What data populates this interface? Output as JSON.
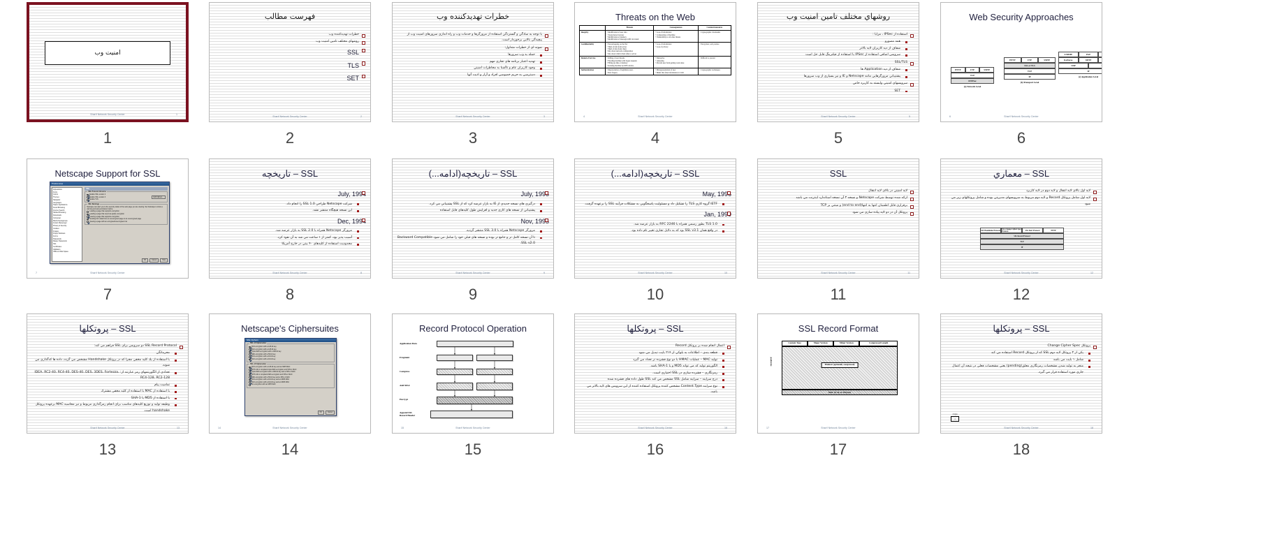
{
  "meta": {
    "footer": "Sharif Network Security Center",
    "app": "slide-sorter-thumbnail-grid",
    "accent_border": "#7b1220",
    "bullet_lvl1": "#8c1a1a",
    "bullet_lvl2": "#a01919"
  },
  "slides": [
    {
      "num": "6",
      "kind": "figure-en",
      "title": "Web Security Approaches",
      "figure": {
        "groups": [
          {
            "caption": "(a) Network Level",
            "rows": [
              [
                "HTTP",
                "FTP",
                "SMTP"
              ],
              [
                "TCP"
              ],
              [
                "IP/IPSec"
              ]
            ]
          },
          {
            "caption": "(b) Transport Level",
            "rows": [
              [
                "HTTP",
                "FTP",
                "SMTP"
              ],
              [
                "SSL or TLS"
              ],
              [
                "TCP"
              ],
              [
                "IP"
              ]
            ]
          },
          {
            "caption": "(c) Application Level",
            "rows": [
              [
                "S/MIME",
                "PGP",
                "SET"
              ],
              [
                "Kerberos",
                "SMTP",
                "HTTP"
              ],
              [
                "UDP",
                "TCP"
              ],
              [
                "IP"
              ]
            ]
          }
        ]
      },
      "pagenum": "6"
    },
    {
      "num": "5",
      "kind": "text-rtl",
      "title": "روشهاي مختلف تامين امنيت وب",
      "bullets": [
        {
          "level": 1,
          "text": "استفاده از IPSec ، مزايا :"
        },
        {
          "level": 2,
          "text": "همه مصورو"
        },
        {
          "level": 2,
          "text": "شفاف از ديد كاربران لايه بالاتر"
        },
        {
          "level": 2,
          "text": "سرويس اضافي استفاده از IPSec با استفاده از فيلترينگ قابل حل است"
        },
        {
          "level": 1,
          "text": "SSL/TLS"
        },
        {
          "level": 2,
          "text": "شفاف از ديد Application ها"
        },
        {
          "level": 2,
          "text": "پشتيباني مرورگرهايي مانند Netscape و IE و نيز بسياري از وب سرورها"
        },
        {
          "level": 1,
          "text": "سرويسهاي امنيتي وابسته به كاربرد خاص"
        },
        {
          "level": 2,
          "text": "SET"
        }
      ],
      "pagenum": "5"
    },
    {
      "num": "4",
      "kind": "table-en",
      "title": "Threats on the Web",
      "table": {
        "headers": [
          "",
          "Threats",
          "Consequences",
          "Countermeasures"
        ],
        "rows": [
          {
            "head": "Integrity",
            "threats": [
              "Modification of user data",
              "Trojan horse browser",
              "Modification of memory",
              "Modification of message traffic in transit"
            ],
            "consequences": [
              "Loss of information",
              "Compromise of machine",
              "Vulnerability to all other threats"
            ],
            "counter": [
              "Cryptographic checksums"
            ]
          },
          {
            "head": "Confidentiality",
            "threats": [
              "Eavesdropping on the Net",
              "Theft of info from server",
              "Theft of data from client",
              "Info about network configuration",
              "Info about which client talks to server"
            ],
            "consequences": [
              "Loss of information",
              "Loss of privacy"
            ],
            "counter": [
              "Encryption, web proxies"
            ]
          },
          {
            "head": "Denial of Service",
            "threats": [
              "Killing of user threads",
              "Flooding machine with bogus requests",
              "Filling up disk or memory",
              "Isolating machine by DNS attacks"
            ],
            "consequences": [
              "Disruptive",
              "Annoying",
              "Prevent user from getting work done"
            ],
            "counter": [
              "Difficult to prevent"
            ]
          },
          {
            "head": "Authentication",
            "threats": [
              "Impersonation of legitimate users",
              "Data forgery"
            ],
            "consequences": [
              "Misrepresentation of user",
              "Belief that false information is valid"
            ],
            "counter": [
              "Cryptographic techniques"
            ]
          }
        ]
      },
      "pagenum": "4"
    },
    {
      "num": "3",
      "kind": "text-rtl",
      "title": "خطرات تهديدكننده وب",
      "bullets": [
        {
          "level": 1,
          "text": "با توجه به سادگي و گستردگي استفاده از مرورگرها و خدمات وب و راه اندازي سرورهاي امنيت وب از پيچيدگي بالايي برخوردار است."
        },
        {
          "level": 1,
          "text": "نمونه اي از خطرات متداول:"
        },
        {
          "level": 2,
          "text": "حمله به وب سرورها"
        },
        {
          "level": 2,
          "text": "تهديد اعتبار برنامه هاي تجاري مهم"
        },
        {
          "level": 2,
          "text": "وجود كاربران عام و ناآشنا به مخاطرات امنيتي"
        },
        {
          "level": 2,
          "text": "دسترسي به حريم خصوصي افراد و آزار و اذيت آنها"
        }
      ],
      "pagenum": "3"
    },
    {
      "num": "2",
      "kind": "text-rtl",
      "title": "فهرست مطالب",
      "bullets": [
        {
          "level": 1,
          "text": "خطرات تهديدكننده وب"
        },
        {
          "level": 1,
          "text": "روشهاي مختلف تامين امنيت وب"
        },
        {
          "level": 1,
          "text": "SSL",
          "big": true
        },
        {
          "level": 1,
          "text": "TLS",
          "big": true
        },
        {
          "level": 1,
          "text": "SET",
          "big": true
        }
      ],
      "pagenum": "2"
    },
    {
      "num": "1",
      "kind": "title-slide",
      "title": "امنيت وب",
      "pagenum": "1"
    },
    {
      "num": "12",
      "kind": "text-rtl-figure",
      "title": "SSL – معماري",
      "bullets": [
        {
          "level": 1,
          "text": "لايه اول بالاي لايه انتقال و لايه دوم در لايه كاربرد"
        },
        {
          "level": 1,
          "text": "لايه اول شامل پروتكل Record و لايه دوم مربوط به سرويسهاي مديريتي بوده و شامل پروتكلهاي زير مي شود"
        }
      ],
      "figure": {
        "rows": [
          [
            "SSL Handshake Protocol",
            "SSL Change Cipher Spec Protocol",
            "SSL Alert Protocol",
            "HTTP"
          ],
          [
            "SSL Record Protocol"
          ],
          [
            "TCP"
          ],
          [
            "IP"
          ]
        ]
      },
      "pagenum": "12"
    },
    {
      "num": "11",
      "kind": "text-rtl",
      "title": "SSL",
      "bullets": [
        {
          "level": 1,
          "text": "لايه امنيتي در بالاي لايه انتقال"
        },
        {
          "level": 1,
          "text": "ارائه شده توسط شركت Netscape و نسخه ۳ آن نسخه استاندارد اينترنت مي باشد"
        },
        {
          "level": 1,
          "text": "برقراري قابل اطمينان انتها به انتها(end to end) و مبتني بر TCP"
        },
        {
          "level": 1,
          "text": "پروتكل آن در دو لايه پياده سازي مي شود"
        }
      ],
      "pagenum": "11"
    },
    {
      "num": "10",
      "kind": "text-rtl",
      "title": "SSL – تاريخچه(ادامه...)",
      "bullets": [
        {
          "level": 1,
          "text": "May, 1996",
          "date": true
        },
        {
          "level": 2,
          "text": "IETF گروه كاري TLS را تشكيل داد و مسئوليت پاسخگويي به مشكلات فرآيند SSL را برعهده گرفت."
        },
        {
          "level": 1,
          "text": "Jan, 1999",
          "date": true
        },
        {
          "level": 2,
          "text": "TLS 1.0 بطور رسمي همراه با RFC 2246 به بازار عرضه شد."
        },
        {
          "level": 2,
          "text": "در واقع همان SSL v3.1 بود كه به دلايل تجاري تغيير نام داده بود."
        }
      ],
      "pagenum": "10"
    },
    {
      "num": "9",
      "kind": "text-rtl",
      "title": "SSL – تاريخچه(ادامه...)",
      "bullets": [
        {
          "level": 1,
          "text": "July, 1995",
          "date": true
        },
        {
          "level": 2,
          "text": "درگيري هاي نسخه جديدي از IE به بازار عرضه كرد كه از SSL پشتيباني مي كرد."
        },
        {
          "level": 2,
          "text": "پشتيباني از نسخه هاي كاري جديد و افزايش طول كليدهاي قابل استفاده"
        },
        {
          "level": 1,
          "text": "Nov, 1995",
          "date": true
        },
        {
          "level": 2,
          "text": "مرورگر Netscape همراه با SSL 3.0 منتشر گرديد."
        },
        {
          "level": 2,
          "text": "تا آن نسخه كامل تر و جامع تر بوده و نسخه هاي قبلي خود را شامل مي شود Backward Compatible .SSL v2.0"
        }
      ],
      "pagenum": "9"
    },
    {
      "num": "8",
      "kind": "text-rtl",
      "title": "SSL – تاريخچه",
      "bullets": [
        {
          "level": 1,
          "text": "July, 1994",
          "date": true
        },
        {
          "level": 2,
          "text": "شركت Netscape طراحي SSL 1.0 را انجام داد."
        },
        {
          "level": 2,
          "text": "اين نسخه هيچگاه منتشر نشد."
        },
        {
          "level": 1,
          "text": "Dec, 1994",
          "date": true
        },
        {
          "level": 2,
          "text": "مرورگر Netscape همراه با SSL 2.0 به بازار عرضه شد."
        },
        {
          "level": 2,
          "text": "آسيب پذير بود، كمتر از ۱ ساعت مي شد به آن نفوذ كرد."
        },
        {
          "level": 2,
          "text": "محدوديت استفاده از كليدهاي ۴۰ بيتي در خارج آمريكا"
        }
      ],
      "pagenum": "8"
    },
    {
      "num": "7",
      "kind": "dialog-en",
      "title": "Netscape Support for SSL",
      "dialog": {
        "titlebar": "Preferences",
        "header": "SSL",
        "tree": [
          "Appearance",
          "Fonts",
          "Colors",
          "Themes",
          "Navigator",
          "Languages",
          "Helper Applications",
          "Smart Browsing",
          "Internet Search",
          "Tabbed Browsing",
          "Downloads",
          "Composer",
          "Mail & Newsgroups",
          "Instant Messenger",
          "Privacy & Security",
          "Cookies",
          "Images",
          "Popup Windows",
          "Forms",
          "Passwords",
          "Master Passwords",
          "SSL",
          "Certificates",
          "Validation",
          "Offline & Disk Space"
        ],
        "groups": [
          {
            "title": "SSL Protocol Versions",
            "items": [
              {
                "label": "Enable SSL version 2",
                "checked": true
              },
              {
                "label": "Enable SSL version 3",
                "checked": true
              },
              {
                "label": "Enable TLS",
                "checked": true
              }
            ],
            "button": "Edit Ciphers..."
          },
          {
            "title": "SSL Warnings",
            "note": "Netscape can alert you to the security status of the web page you are viewing. Set Netscape to show a warning and ask permission before:",
            "items": [
              {
                "label": "Loading a page that supports encryption",
                "checked": false
              },
              {
                "label": "Loading a page that uses low-grade encryption",
                "checked": true
              },
              {
                "label": "Leaving a page that supports encryption",
                "checked": true
              },
              {
                "label": "Sending form data from an unencrypted page to an unencrypted page",
                "checked": false
              },
              {
                "label": "Viewing a page with an encrypted/unencrypted mix",
                "checked": true
              }
            ]
          }
        ],
        "buttons": [
          "OK",
          "Cancel",
          "Help"
        ]
      },
      "pagenum": "7"
    },
    {
      "num": "18",
      "kind": "text-rtl-figure2",
      "title": "SSL – پروتكلها",
      "bullets": [
        {
          "level": 1,
          "text": "پروتكل Change Cipher Spec"
        },
        {
          "level": 2,
          "text": "يكي از ۳ پروتكل لايه دوم SSL كه از پروتكل Record استفاده مي كند"
        },
        {
          "level": 2,
          "text": "شامل ۱ بايت مي باشد"
        },
        {
          "level": 2,
          "text": "منجر به توليد شدن مشخصات رمزنگاري معلق(pending) بعني مشخصات فعلي در نتيجه آن اعمال جاري مورد استفاده قرار مي گيرد."
        }
      ],
      "figure": {
        "label": "1 byte",
        "cell": "1"
      },
      "pagenum": "18"
    },
    {
      "num": "17",
      "kind": "recordformat",
      "title": "SSL Record Format",
      "figure": {
        "header": [
          "Content Type",
          "Major Version",
          "Minor Version",
          "Compressed Length"
        ],
        "plaintext": "Plaintext (optionally compressed)",
        "mac": "MAC (0, 16, or 20 bytes)",
        "side": "encrypted"
      },
      "pagenum": "17"
    },
    {
      "num": "16",
      "kind": "text-rtl",
      "title": "SSL – پروتكلها",
      "bullets": [
        {
          "level": 1,
          "text": "اعمال انجام شده بر پروتكل Record"
        },
        {
          "level": 2,
          "text": "قطعه بندي – اطلاعات به بلوكي از ۲۱۴ بايت تبديل مي شود"
        },
        {
          "level": 2,
          "text": "توليد MAC – عمليات HMAC با دو نوع فشرده تر تعداد مي گيرد"
        },
        {
          "level": 2,
          "text": "الگوريتم توليد كد مي تواند MD5 و يا SHA-1 باشد."
        },
        {
          "level": 2,
          "text": "رمزنگاري – فشرده سازي در SSL اختياري است."
        },
        {
          "level": 2,
          "text": "درج سرايند – سرايند شامل SSL مشخص مي كند SSL طول داده هاي فشرده شده"
        },
        {
          "level": 2,
          "text": "نوع سرايند Content Type مشخص كننده پروتكل استفاده كننده از اين سرويس هاي لايه بالاتر مي باشد."
        }
      ],
      "pagenum": "16"
    },
    {
      "num": "15",
      "kind": "rpo",
      "title": "Record Protocol Operation",
      "figure": {
        "labels": [
          "Application Data",
          "Fragment",
          "Compress",
          "Add MAC",
          "Encrypt",
          "Append SSL Record Header"
        ]
      },
      "pagenum": "15"
    },
    {
      "num": "14",
      "kind": "dialog2-en",
      "title": "Netscape's Ciphersuites",
      "dialog": {
        "titlebar": "SSL Ciphers",
        "groups": [
          {
            "title": "SSL v2 Ciphersuites",
            "items": [
              {
                "label": "RC4 encryption with a 128-bit key",
                "checked": true
              },
              {
                "label": "RC2 encryption with a 128-bit key",
                "checked": true
              },
              {
                "label": "Triple DES encryption with a 168-bit key",
                "checked": true
              },
              {
                "label": "DES encryption with a 56-bit key",
                "checked": true
              },
              {
                "label": "RC4 encryption with a 40-bit key",
                "checked": true
              },
              {
                "label": "RC2 encryption with a 40-bit key",
                "checked": true
              }
            ]
          },
          {
            "title": "SSL v3 Ciphersuites",
            "items": [
              {
                "label": "RC4 encryption with a 128-bit key and an MD5 MAC",
                "checked": true
              },
              {
                "label": "FIPS 140-1 compliant triple DES encryption and SHA-1 MAC",
                "checked": true
              },
              {
                "label": "Triple DES encryption with a 168-bit key and a SHA-1 MAC",
                "checked": true
              },
              {
                "label": "FIPS 140-1 compliant DES encryption and SHA-1 MAC",
                "checked": true
              },
              {
                "label": "DES encryption with a 56-bit key and a SHA-1 MAC",
                "checked": true
              },
              {
                "label": "RC4 encryption with a 40-bit key and an MD5 MAC",
                "checked": true
              },
              {
                "label": "RC2 encryption with a 40-bit key and an MD5 MAC",
                "checked": true
              },
              {
                "label": "No encryption with an MD5 MAC",
                "checked": false
              }
            ]
          }
        ],
        "buttons": [
          "OK",
          "Cancel"
        ]
      },
      "pagenum": "14"
    },
    {
      "num": "13",
      "kind": "text-rtl",
      "title": "SSL – پروتكلها",
      "bullets": [
        {
          "level": 1,
          "text": "SSL Record Protocol دو سرويس براي SSL فراهم مي كند:"
        },
        {
          "level": 2,
          "text": "محرمانگي"
        },
        {
          "level": 2,
          "text": "با استفاده از يك كليد مخفي مجزا كه در پروتكل Handshake مشخص مي گردد، داده ها كدگذاري مي شوند."
        },
        {
          "level": 2,
          "text": "تعدادي از الگوريتمهاي رمز عبارتند از: IDEA، RC2-40، RC4-40، DES-40، DES، 3DES، Fortezza، RC4-128، RC2-128"
        },
        {
          "level": 2,
          "text": "تماميت پيام"
        },
        {
          "level": 2,
          "text": "با استفاده از MAC با استفاده از كليد مخفي مشترك"
        },
        {
          "level": 2,
          "text": "با استفاده از MD5 يا SHA-1"
        },
        {
          "level": 2,
          "text": "وظيفه توليد و توزيع كليدهاي مناسب براي انجام رمزگذاري مربوط و نيز محاسبه MAC برعهده پروتكل handshake است."
        }
      ],
      "pagenum": "13"
    }
  ]
}
